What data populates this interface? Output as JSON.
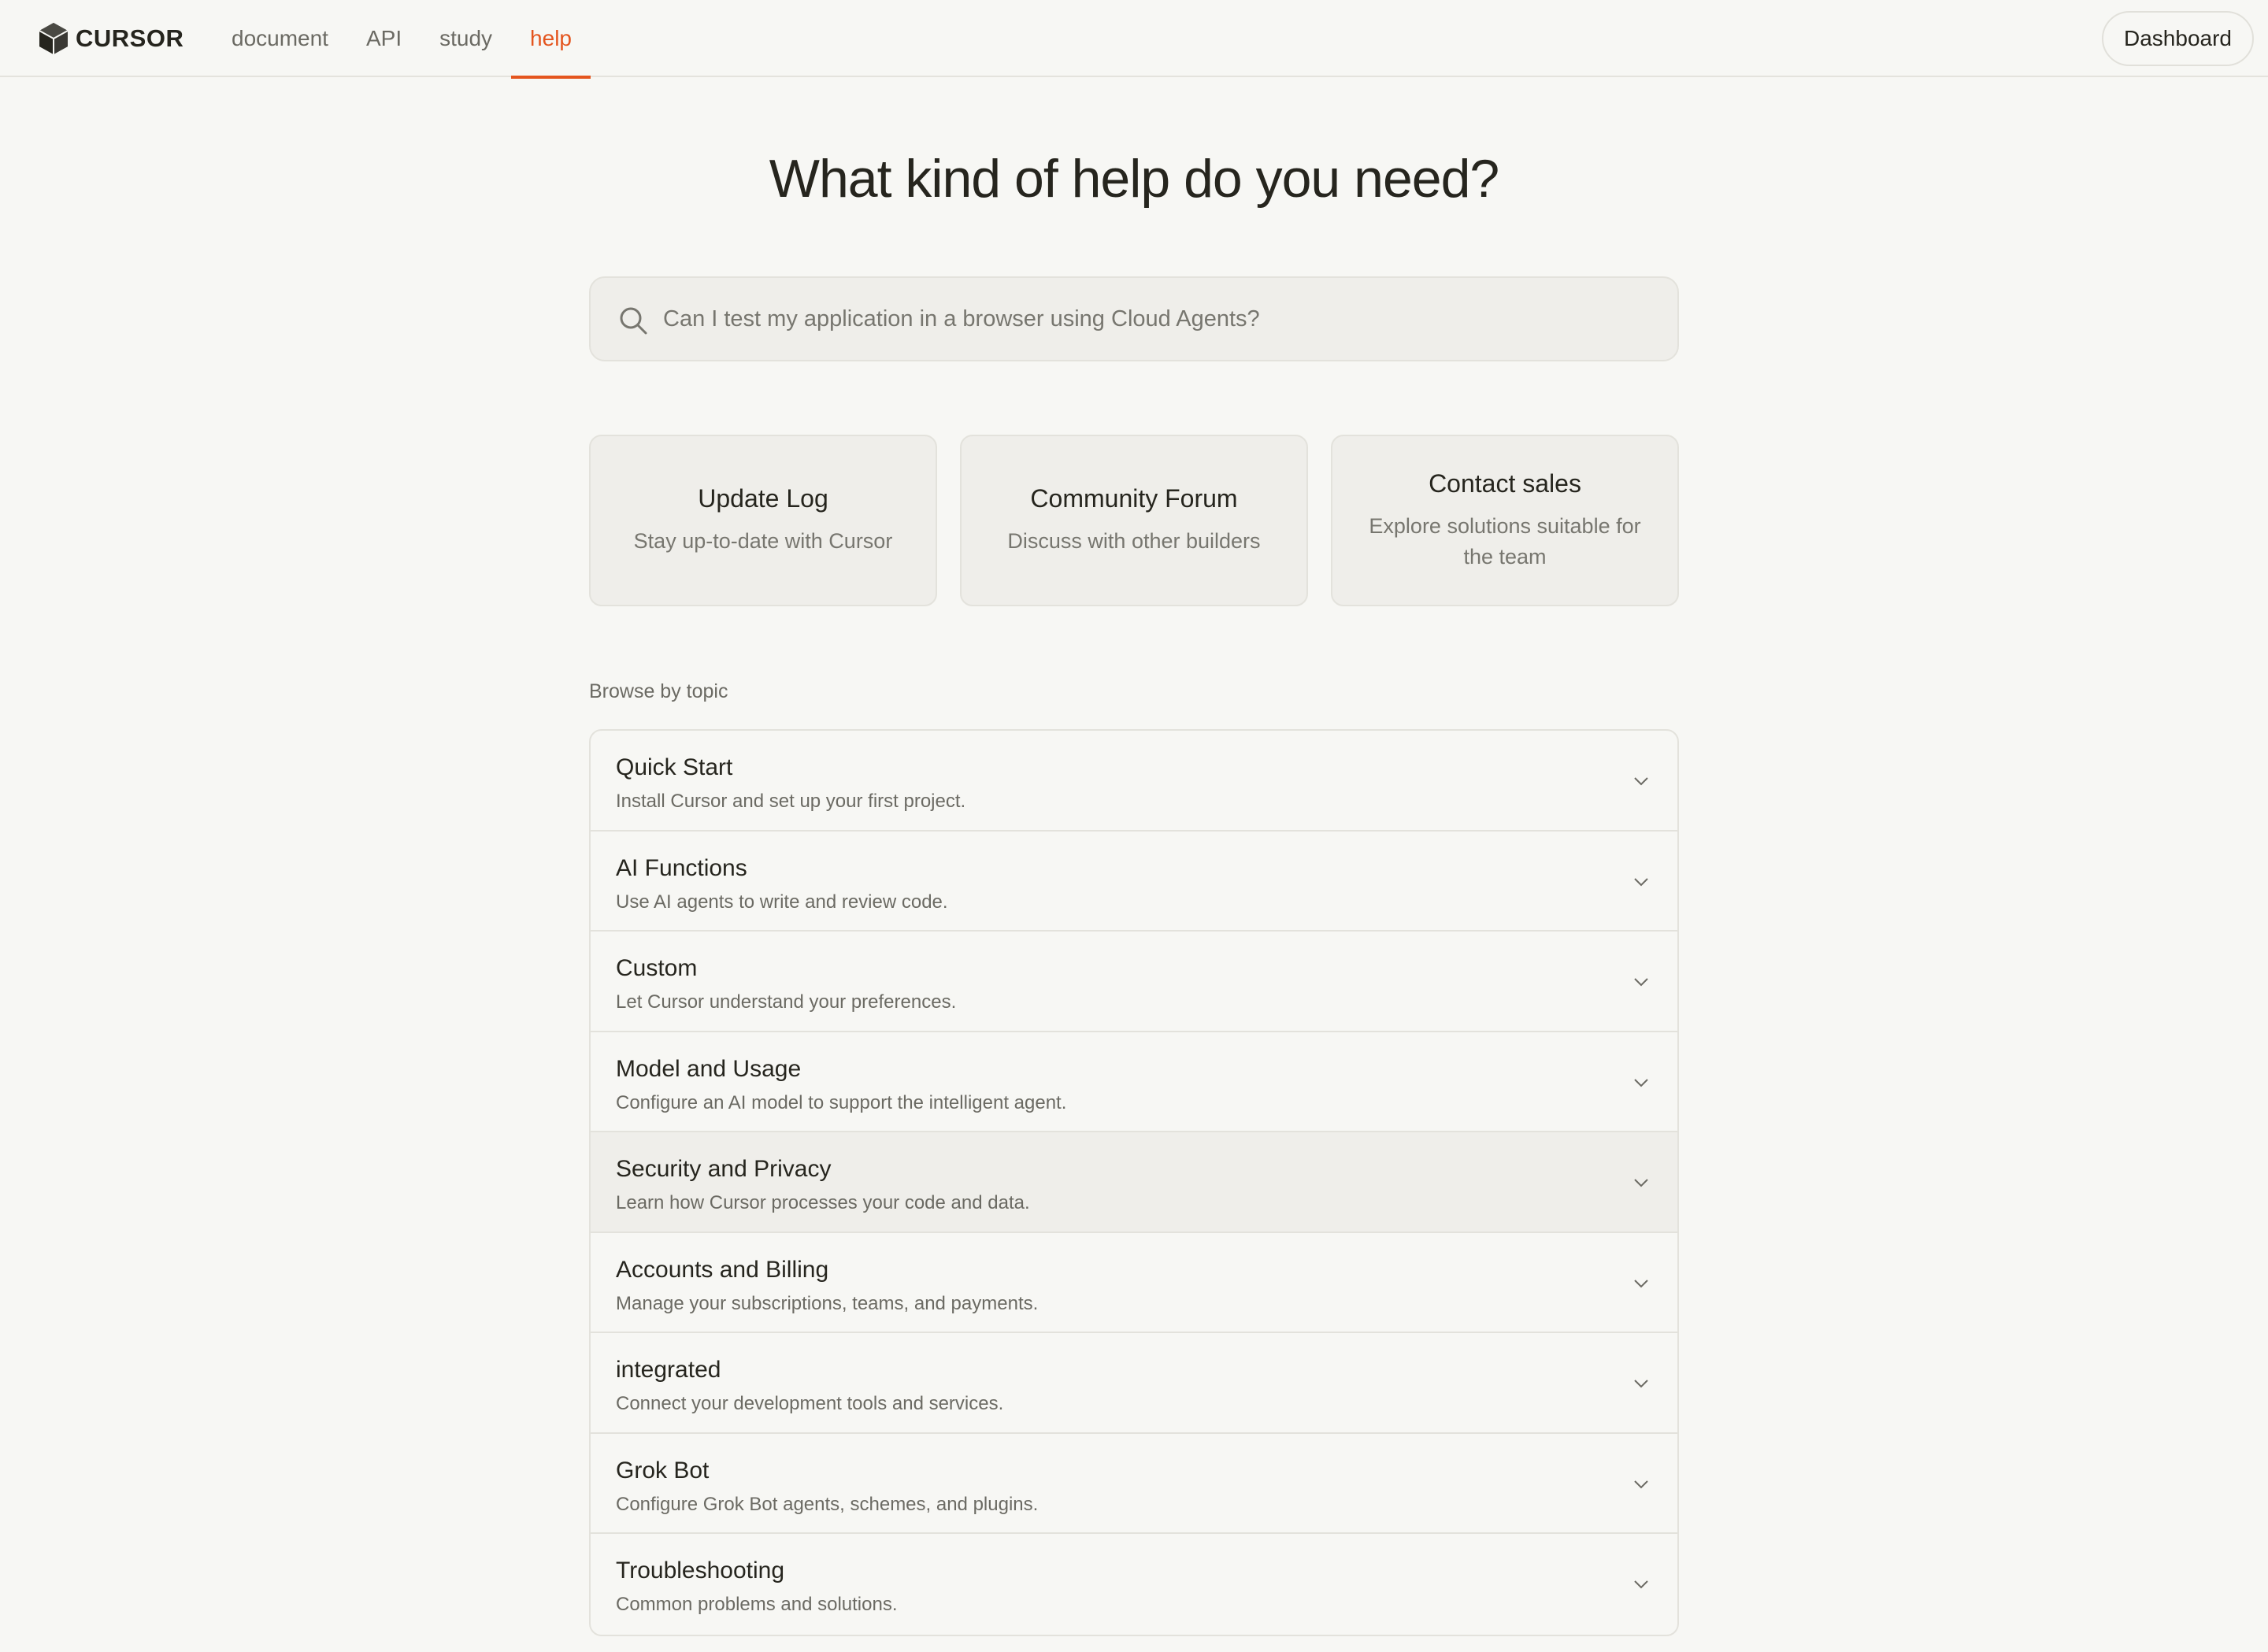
{
  "header": {
    "logo_text": "CURSOR",
    "nav": [
      {
        "label": "document",
        "active": false
      },
      {
        "label": "API",
        "active": false
      },
      {
        "label": "study",
        "active": false
      },
      {
        "label": "help",
        "active": true
      }
    ],
    "dashboard_label": "Dashboard",
    "accent_color": "#e4551e"
  },
  "main": {
    "title": "What kind of help do you need?",
    "search": {
      "placeholder": "Can I test my application in a browser using Cloud Agents?",
      "icon": "search-icon"
    },
    "cards": [
      {
        "title": "Update Log",
        "desc": "Stay up-to-date with Cursor"
      },
      {
        "title": "Community Forum",
        "desc": "Discuss with other builders"
      },
      {
        "title": "Contact sales",
        "desc": "Explore solutions suitable for the team"
      }
    ],
    "browse_label": "Browse by topic",
    "topics": [
      {
        "title": "Quick Start",
        "desc": "Install Cursor and set up your first project."
      },
      {
        "title": "AI Functions",
        "desc": "Use AI agents to write and review code."
      },
      {
        "title": "Custom",
        "desc": "Let Cursor understand your preferences."
      },
      {
        "title": "Model and Usage",
        "desc": "Configure an AI model to support the intelligent agent."
      },
      {
        "title": "Security and Privacy",
        "desc": "Learn how Cursor processes your code and data."
      },
      {
        "title": "Accounts and Billing",
        "desc": "Manage your subscriptions, teams, and payments."
      },
      {
        "title": "integrated",
        "desc": "Connect your development tools and services."
      },
      {
        "title": "Grok Bot",
        "desc": "Configure Grok Bot agents, schemes, and plugins."
      },
      {
        "title": "Troubleshooting",
        "desc": "Common problems and solutions."
      }
    ]
  }
}
